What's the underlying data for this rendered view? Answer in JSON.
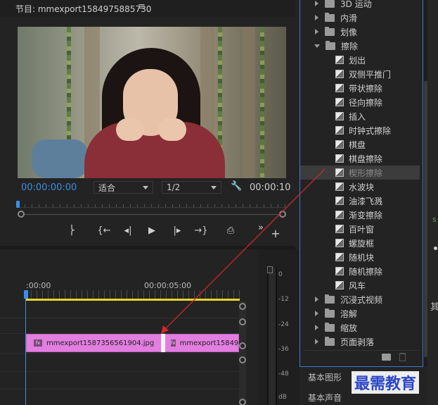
{
  "monitor": {
    "title": "节目: mmexport1584975885730",
    "menu_glyph": "≡",
    "timecode": "00:00:00:00",
    "fit_label": "适合",
    "resolution_label": "1/2",
    "duration": "00:00:10",
    "controls": {
      "mark": "⎬",
      "go_in": "{←",
      "step_back": "◂|",
      "play": "▶",
      "step_fwd": "|▸",
      "go_out": "→}",
      "export": "⎙",
      "more": "»",
      "add": "+"
    }
  },
  "timeline": {
    "time_start": ":00:00",
    "time_mark": "00:00:05:00",
    "clips": [
      {
        "name": "mmexport1587356561904.jpg"
      },
      {
        "name": "mmexport1584975"
      }
    ],
    "fx_badge": "fx"
  },
  "meter": {
    "db_labels": [
      "0",
      "-12",
      "-24",
      "-36",
      "-48",
      "dB"
    ],
    "handle": "◫"
  },
  "effects": {
    "items": [
      {
        "label": "3D 运动",
        "kind": "folder",
        "expanded": false
      },
      {
        "label": "内滑",
        "kind": "folder",
        "expanded": false
      },
      {
        "label": "划像",
        "kind": "folder",
        "expanded": false
      },
      {
        "label": "擦除",
        "kind": "folder",
        "expanded": true
      },
      {
        "label": "划出",
        "kind": "effect"
      },
      {
        "label": "双侧平推门",
        "kind": "effect"
      },
      {
        "label": "带状擦除",
        "kind": "effect"
      },
      {
        "label": "径向擦除",
        "kind": "effect"
      },
      {
        "label": "插入",
        "kind": "effect"
      },
      {
        "label": "时钟式擦除",
        "kind": "effect"
      },
      {
        "label": "棋盘",
        "kind": "effect"
      },
      {
        "label": "棋盘擦除",
        "kind": "effect"
      },
      {
        "label": "楔形擦除",
        "kind": "effect",
        "selected": true
      },
      {
        "label": "水波块",
        "kind": "effect"
      },
      {
        "label": "油漆飞溅",
        "kind": "effect"
      },
      {
        "label": "渐变擦除",
        "kind": "effect"
      },
      {
        "label": "百叶窗",
        "kind": "effect"
      },
      {
        "label": "螺旋框",
        "kind": "effect"
      },
      {
        "label": "随机块",
        "kind": "effect"
      },
      {
        "label": "随机擦除",
        "kind": "effect"
      },
      {
        "label": "风车",
        "kind": "effect"
      },
      {
        "label": "沉浸式视频",
        "kind": "folder",
        "expanded": false
      },
      {
        "label": "溶解",
        "kind": "folder",
        "expanded": false
      },
      {
        "label": "缩放",
        "kind": "folder",
        "expanded": false
      },
      {
        "label": "页面剥落",
        "kind": "folder",
        "expanded": false
      }
    ]
  },
  "panels": {
    "essential_graphics": "基本图形",
    "essential_sound": "基本声音"
  },
  "sliver": {
    "char": "其",
    "green": "s"
  },
  "watermark": "最需教育",
  "colors": {
    "accent_blue": "#3a8ee6",
    "clip_pink": "#e27ee0",
    "work_area_yellow": "#e6d42a",
    "arrow_red": "#d9262b",
    "panel_focus_border": "#3a7bd5"
  }
}
